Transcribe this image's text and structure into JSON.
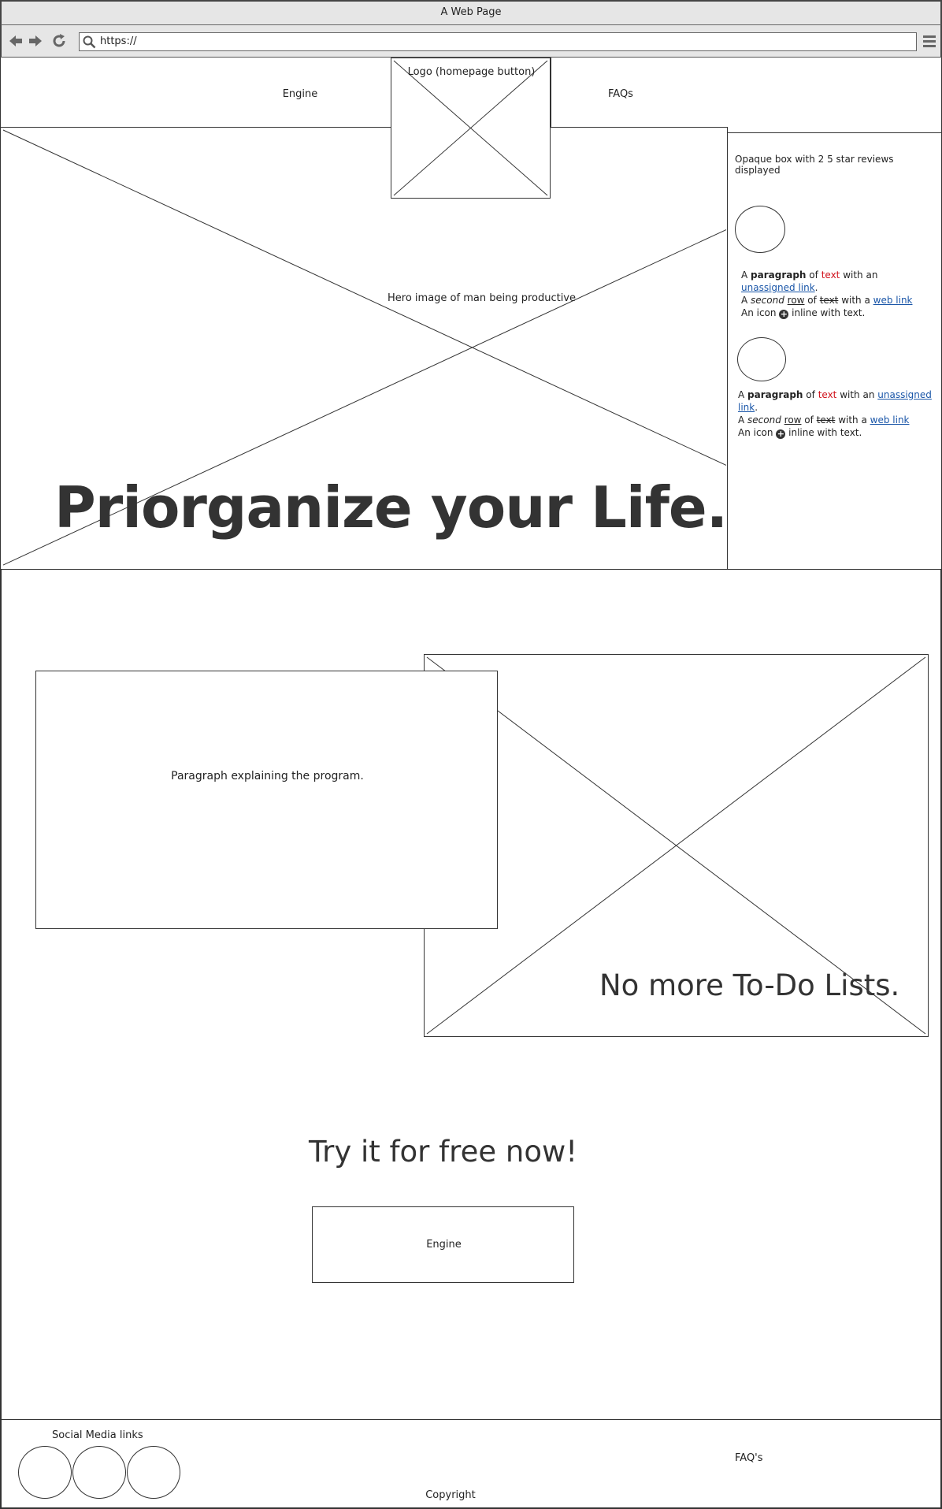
{
  "browser": {
    "window_title": "A Web Page",
    "url": "https://"
  },
  "nav": {
    "left_link": "Engine",
    "logo_label": "Logo (homepage button)",
    "right_link": "FAQs"
  },
  "hero": {
    "image_label": "Hero image of man being productive",
    "headline": "Priorganize your Life."
  },
  "reviews": {
    "title": "Opaque box with 2 5 star reviews displayed",
    "items": [
      {
        "p1_a": "A ",
        "p1_bold": "paragraph",
        "p1_b": " of ",
        "p1_red": "text",
        "p1_c": " with an ",
        "p1_link": "unassigned link",
        "p1_d": ".",
        "p2_a": "A ",
        "p2_ital": "second",
        "p2_b": " ",
        "p2_under": "row",
        "p2_c": " of ",
        "p2_strike": "text",
        "p2_d": " with a ",
        "p2_link": "web link",
        "p3_a": "An icon ",
        "p3_b": " inline with text."
      },
      {
        "p1_a": "A ",
        "p1_bold": "paragraph",
        "p1_b": " of ",
        "p1_red": "text",
        "p1_c": " with an ",
        "p1_link": "unassigned link",
        "p1_d": ".",
        "p2_a": "A ",
        "p2_ital": "second",
        "p2_b": " ",
        "p2_under": "row",
        "p2_c": " of ",
        "p2_strike": "text",
        "p2_d": " with a ",
        "p2_link": "web link",
        "p3_a": "An icon ",
        "p3_b": " inline with text."
      }
    ]
  },
  "program": {
    "paragraph": "Paragraph explaining the program.",
    "image_caption": "No more To-Do Lists."
  },
  "cta": {
    "heading": "Try it for free now!",
    "button_label": "Engine"
  },
  "footer": {
    "social_label": "Social Media links",
    "faq_link": "FAQ's",
    "copyright": "Copyright"
  },
  "colors": {
    "link": "#1a56a8",
    "red_text": "#d0101a",
    "chrome": "#e6e6e6"
  }
}
